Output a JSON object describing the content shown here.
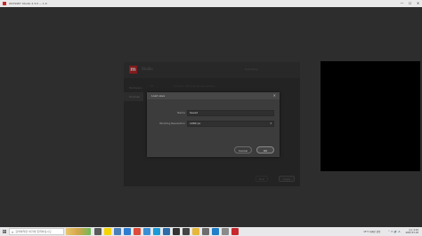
{
  "window": {
    "title": "ODYSSEY Studio 2.3.0 — 1.0",
    "controls": [
      "—",
      "☐",
      "✕"
    ]
  },
  "settings_panel": {
    "logo": "m",
    "app_name": "Studio",
    "summary_label": "Summary",
    "sidebar": [
      "Hardware",
      "Sources"
    ],
    "tabs": [
      "ID",
      "Monitor / Broadcast Resolution"
    ],
    "exit_label": "Exit",
    "next_label": "Apply"
  },
  "modal": {
    "title": "Load save",
    "close": "✕",
    "name_label": "Name",
    "name_value": "Saved",
    "resolution_label": "Working Resolution",
    "resolution_value": "1080 px",
    "cancel_label": "Cancel",
    "ok_label": "OK"
  },
  "taskbar": {
    "search_placeholder": "검색하려면 여기에 입력하십시오",
    "icons": [
      {
        "name": "task-view-icon",
        "color": "#5a5a5a"
      },
      {
        "name": "kakaotalk-icon",
        "color": "#f5d400"
      },
      {
        "name": "files-icon",
        "color": "#4b7fb8"
      },
      {
        "name": "calendar-icon",
        "color": "#2e7dd1"
      },
      {
        "name": "chrome-icon",
        "color": "#dd4b39"
      },
      {
        "name": "store-icon",
        "color": "#3a8ed6"
      },
      {
        "name": "edge-icon",
        "color": "#1a9bd7"
      },
      {
        "name": "code-icon",
        "color": "#2c6ca8"
      },
      {
        "name": "terminal-icon",
        "color": "#333333"
      },
      {
        "name": "app-icon",
        "color": "#444444"
      },
      {
        "name": "explorer-icon",
        "color": "#e6b73a"
      },
      {
        "name": "settings-icon",
        "color": "#6d6d6d"
      },
      {
        "name": "vscode-icon",
        "color": "#1f7fc8"
      },
      {
        "name": "notes-icon",
        "color": "#8a8a8a"
      },
      {
        "name": "studio-icon",
        "color": "#c8282d"
      }
    ],
    "weather": "13°C 대체로 맑음",
    "sys_icons": "⌃ ▭ 🔊 A",
    "time": "오후 4:19",
    "date": "2022-07-03"
  }
}
